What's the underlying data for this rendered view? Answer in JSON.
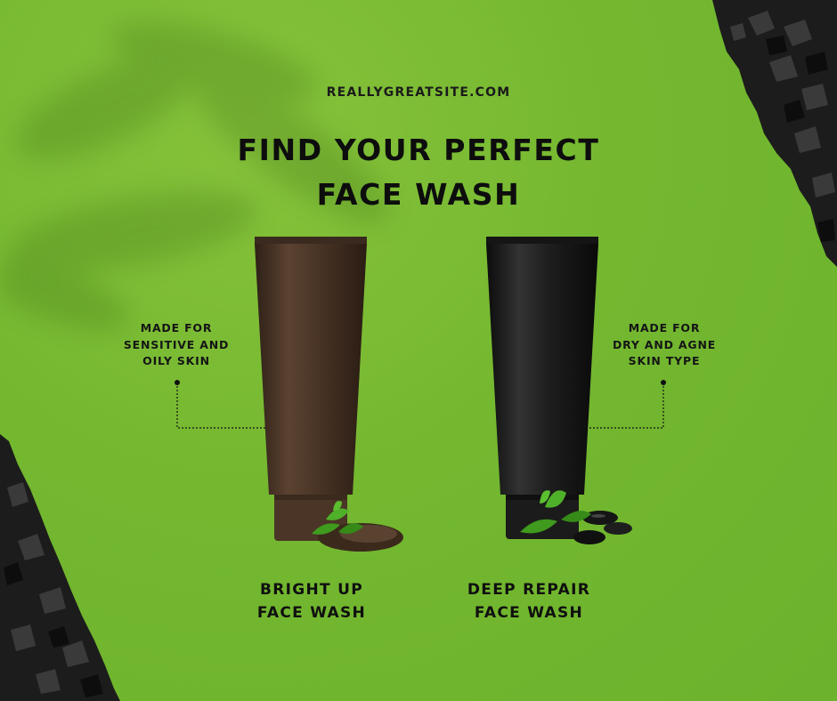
{
  "site": {
    "url": "REALLYGREATSITE.COM"
  },
  "headline": {
    "line1": "FIND YOUR PERFECT",
    "line2": "FACE WASH"
  },
  "products": [
    {
      "callout": [
        "MADE FOR",
        "SENSITIVE AND",
        "OILY SKIN"
      ],
      "name": [
        "BRIGHT UP",
        "FACE WASH"
      ],
      "tube_color": "#4a3526"
    },
    {
      "callout": [
        "MADE FOR",
        "DRY AND AGNE",
        "SKIN TYPE"
      ],
      "name": [
        "DEEP REPAIR",
        "FACE WASH"
      ],
      "tube_color": "#1b1b1b"
    }
  ],
  "colors": {
    "background": "#74b830",
    "charcoal": "#1c1c1c",
    "text": "#111111",
    "leaf": "#3f9a1e"
  },
  "icons": [
    "leaf-shadow",
    "charcoal-chunk",
    "tea-leaves",
    "black-stones"
  ]
}
